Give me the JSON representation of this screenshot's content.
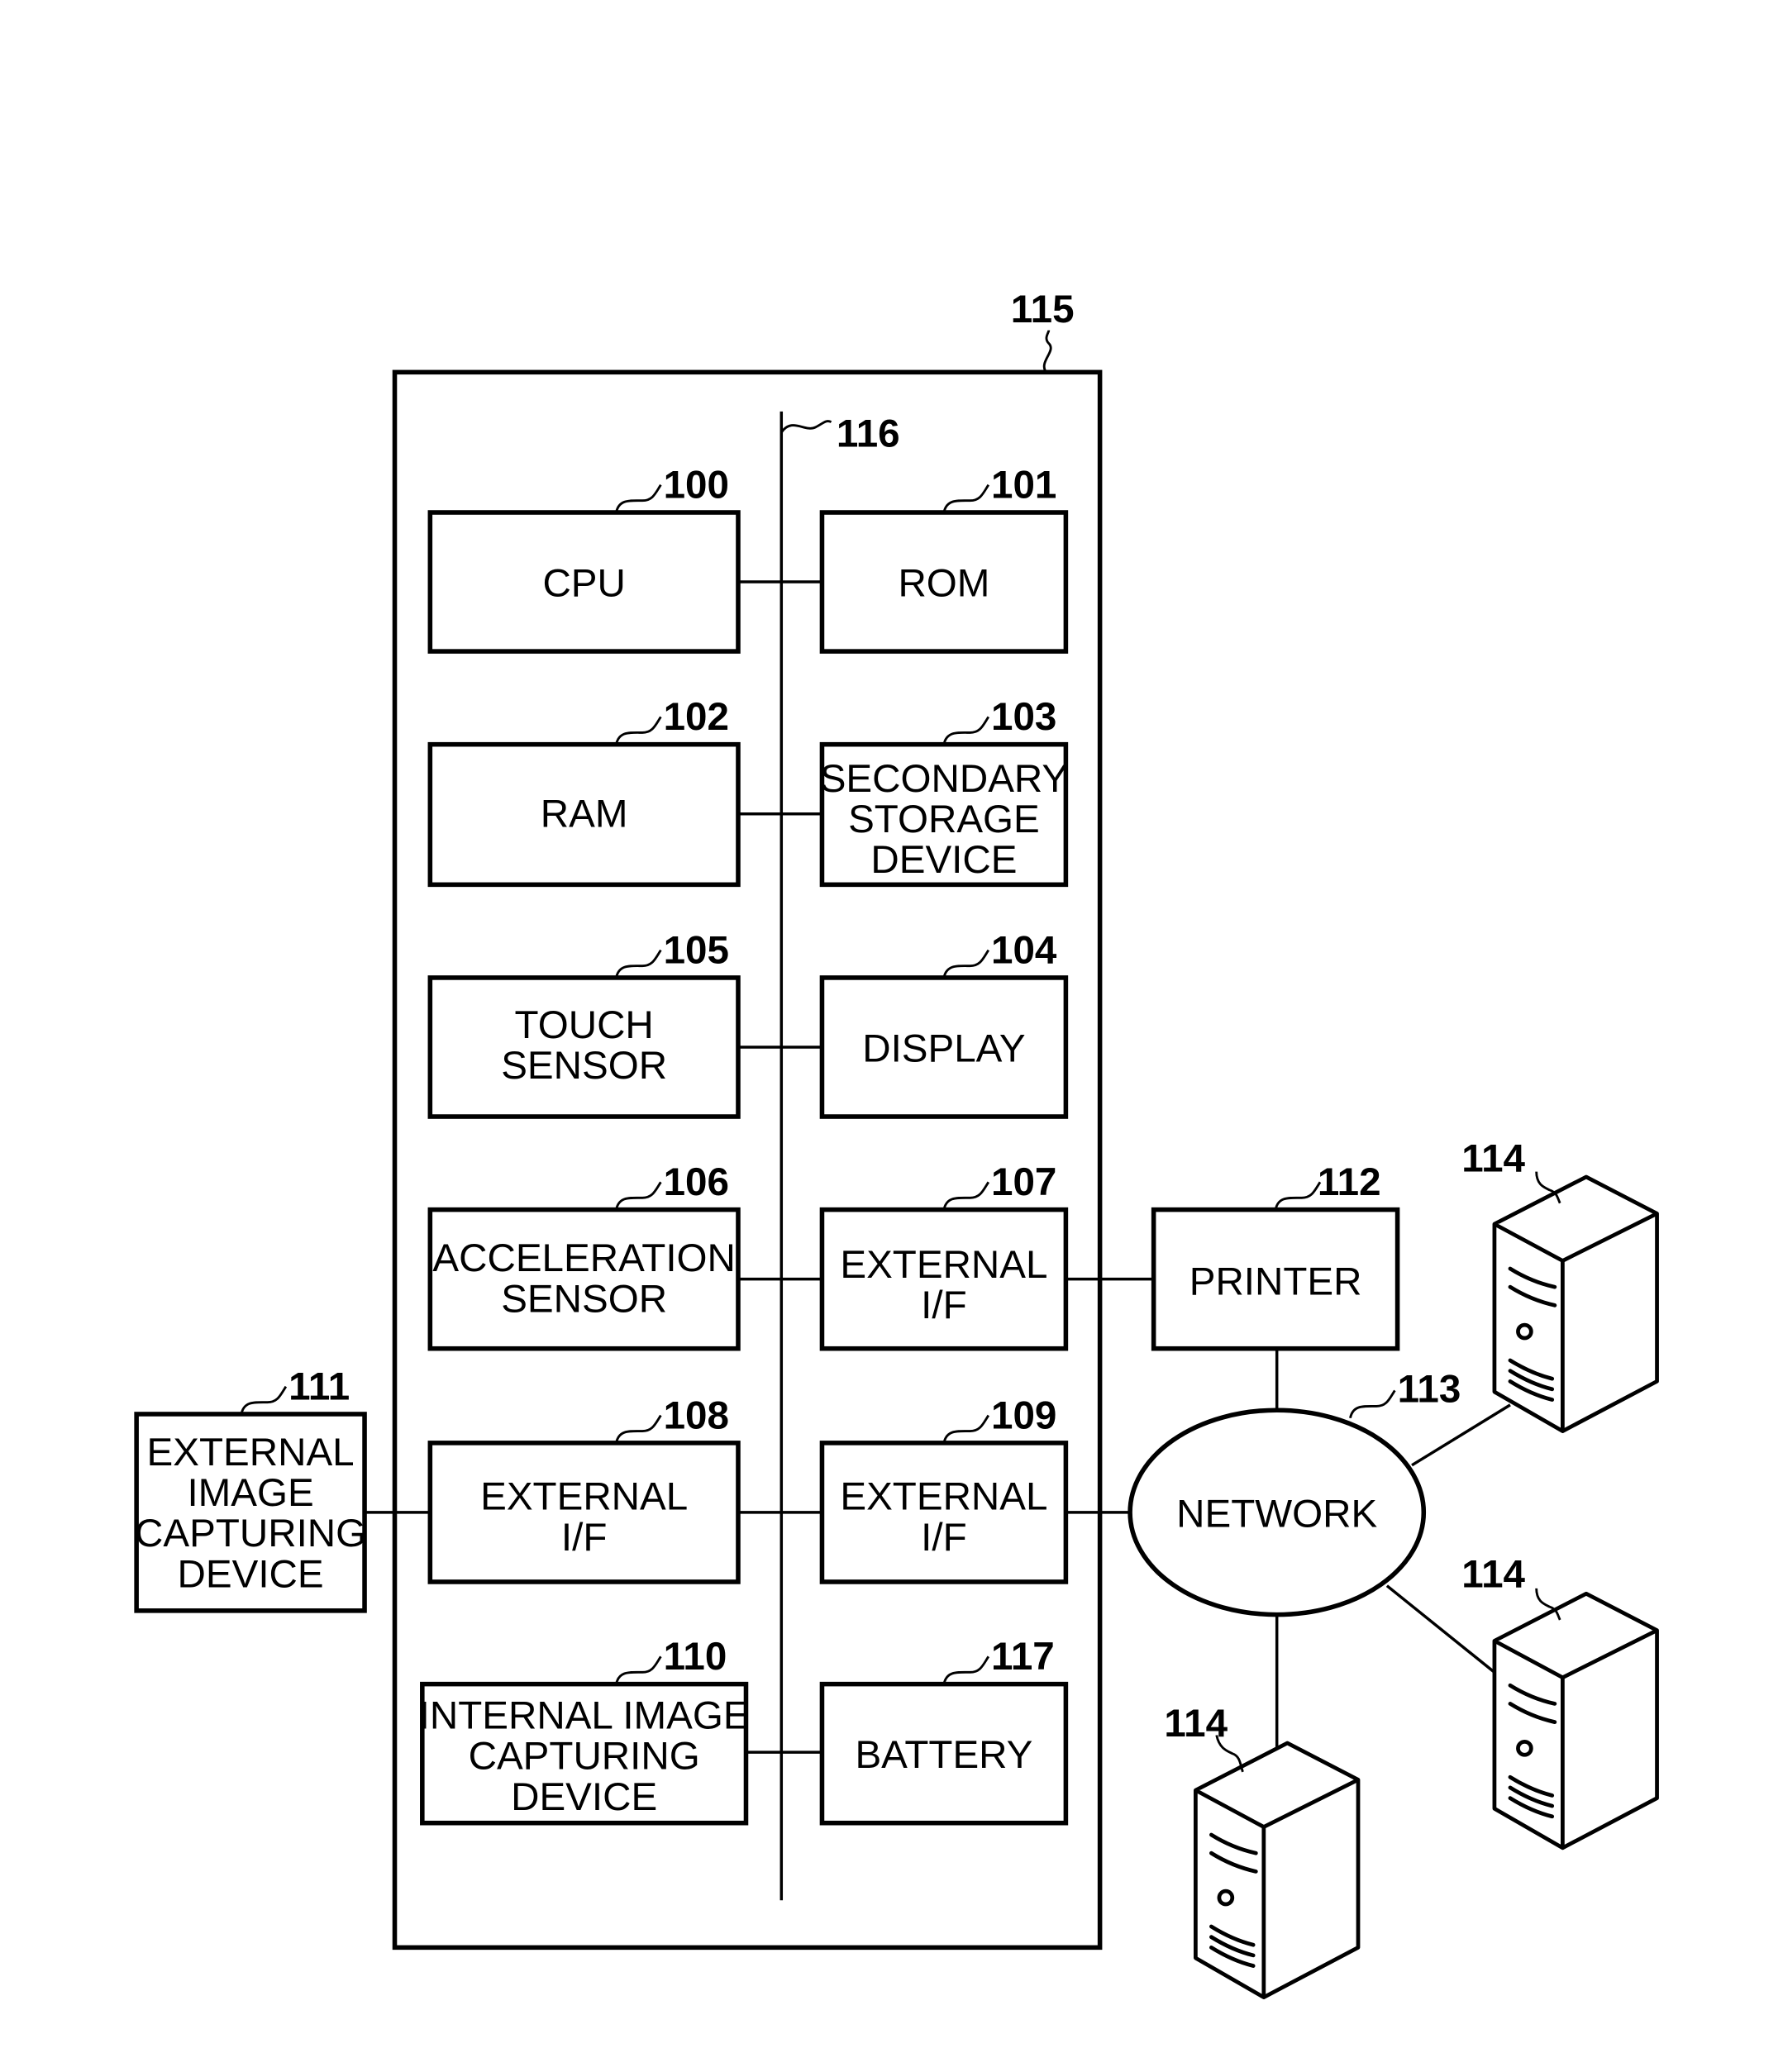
{
  "figure": {
    "device_ref": "115",
    "bus_ref": "116",
    "network": {
      "ref": "113",
      "label": "NETWORK"
    },
    "printer": {
      "ref": "112",
      "label": "PRINTER"
    },
    "servers": [
      {
        "ref": "114"
      },
      {
        "ref": "114"
      },
      {
        "ref": "114"
      }
    ],
    "external_device": {
      "ref": "111",
      "lines": [
        "EXTERNAL",
        "IMAGE",
        "CAPTURING",
        "DEVICE"
      ]
    },
    "blocks": [
      {
        "ref": "100",
        "lines": [
          "CPU"
        ]
      },
      {
        "ref": "101",
        "lines": [
          "ROM"
        ]
      },
      {
        "ref": "102",
        "lines": [
          "RAM"
        ]
      },
      {
        "ref": "103",
        "lines": [
          "SECONDARY",
          "STORAGE",
          "DEVICE"
        ]
      },
      {
        "ref": "105",
        "lines": [
          "TOUCH",
          "SENSOR"
        ]
      },
      {
        "ref": "104",
        "lines": [
          "DISPLAY"
        ]
      },
      {
        "ref": "106",
        "lines": [
          "ACCELERATION",
          "SENSOR"
        ]
      },
      {
        "ref": "107",
        "lines": [
          "EXTERNAL",
          "I/F"
        ]
      },
      {
        "ref": "108",
        "lines": [
          "EXTERNAL",
          "I/F"
        ]
      },
      {
        "ref": "109",
        "lines": [
          "EXTERNAL",
          "I/F"
        ]
      },
      {
        "ref": "110",
        "lines": [
          "INTERNAL IMAGE",
          "CAPTURING",
          "DEVICE"
        ]
      },
      {
        "ref": "117",
        "lines": [
          "BATTERY"
        ]
      }
    ]
  }
}
